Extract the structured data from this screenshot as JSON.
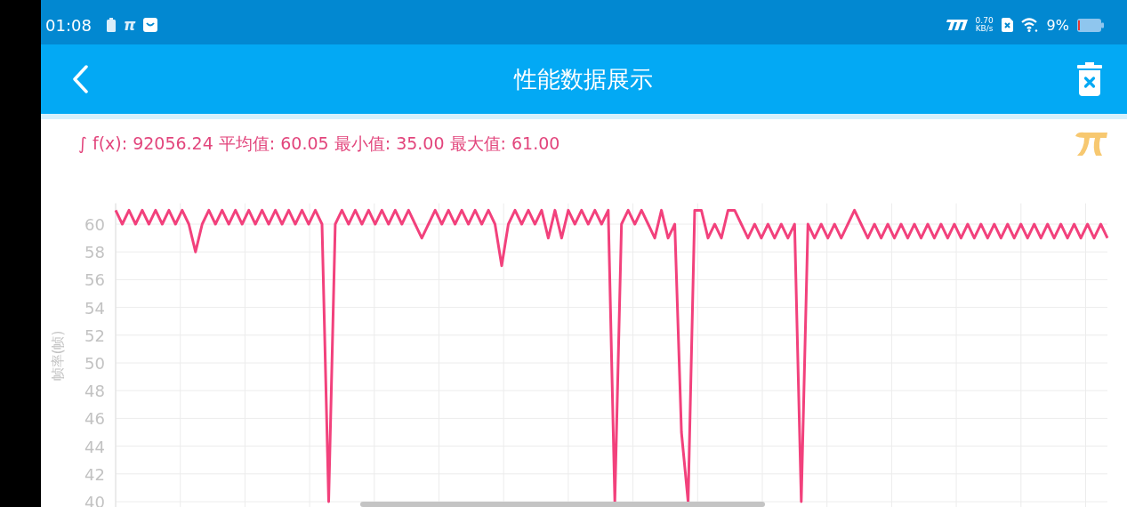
{
  "status_bar": {
    "time": "01:08",
    "pi_glyph": "π",
    "speed_value": "0.70",
    "speed_unit": "KB/s",
    "battery_percent": "9%"
  },
  "app_bar": {
    "title": "性能数据展示"
  },
  "summary": "∫ f(x): 92056.24 平均值: 60.05 最小值: 35.00 最大值: 61.00",
  "chart": {
    "chart_data": {
      "type": "line",
      "ylabel": "帧率(帧)",
      "ylim": [
        40,
        61.5
      ],
      "yticks": [
        40,
        42,
        44,
        46,
        48,
        50,
        52,
        54,
        56,
        58,
        60
      ],
      "grid": true,
      "series": [
        {
          "color": "#f2417c",
          "values": [
            61,
            60,
            61,
            60,
            61,
            60,
            61,
            60,
            61,
            60,
            61,
            60,
            58,
            60,
            61,
            60,
            61,
            60,
            61,
            60,
            61,
            60,
            61,
            60,
            61,
            60,
            61,
            60,
            61,
            60,
            61,
            60,
            40,
            60,
            61,
            60,
            61,
            60,
            61,
            60,
            61,
            60,
            61,
            60,
            61,
            60,
            59,
            60,
            61,
            60,
            61,
            60,
            61,
            60,
            61,
            60,
            61,
            60,
            57,
            60,
            61,
            60,
            61,
            60,
            61,
            59,
            61,
            59,
            61,
            60,
            61,
            60,
            61,
            60,
            61,
            40,
            60,
            61,
            60,
            61,
            60,
            59,
            61,
            59,
            60,
            45,
            40,
            61,
            61,
            59,
            60,
            59,
            61,
            61,
            60,
            59,
            60,
            59,
            60,
            59,
            60,
            59,
            60,
            40,
            60,
            59,
            60,
            59,
            60,
            59,
            60,
            61,
            60,
            59,
            60,
            59,
            60,
            59,
            60,
            59,
            60,
            59,
            60,
            59,
            60,
            59,
            60,
            59,
            60,
            59,
            60,
            59,
            60,
            59,
            60,
            59,
            60,
            59,
            60,
            59,
            60,
            59,
            60,
            59,
            60,
            59,
            60,
            59,
            60,
            59
          ]
        }
      ]
    }
  }
}
